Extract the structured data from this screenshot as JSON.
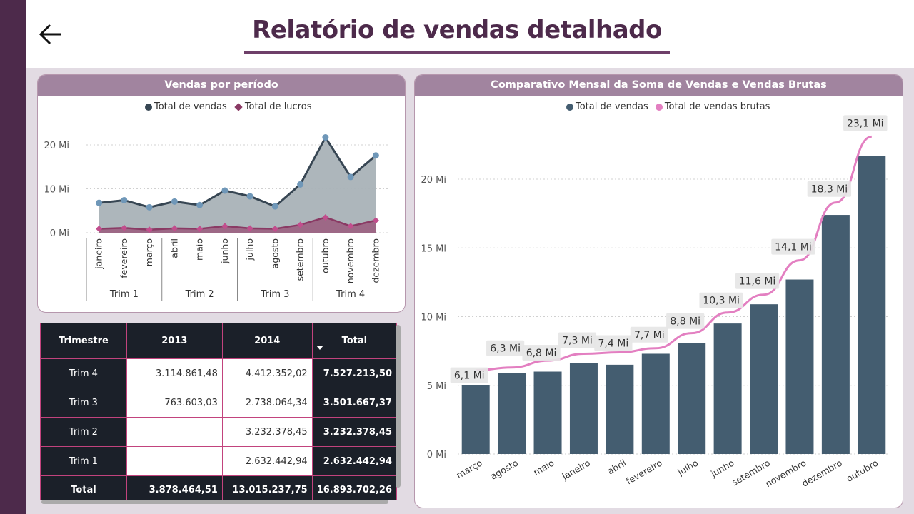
{
  "header": {
    "title": "Relatório de vendas detalhado",
    "back_icon": "arrow-left-icon"
  },
  "colors": {
    "sidebar": "#4d2a4b",
    "card_header": "#a1849f",
    "sales": "#374653",
    "profit": "#8a3a64",
    "gross": "#e37fc1",
    "bar": "#445d70"
  },
  "left_chart": {
    "header": "Vendas por período",
    "legend": [
      "Total de vendas",
      "Total de lucros"
    ]
  },
  "right_chart": {
    "header": "Comparativo Mensal da Soma de Vendas e Vendas Brutas",
    "legend": [
      "Total de vendas",
      "Total de vendas brutas"
    ]
  },
  "table": {
    "headers": [
      "Trimestre",
      "2013",
      "2014",
      "Total"
    ],
    "rows": [
      [
        "Trim 4",
        "3.114.861,48",
        "4.412.352,02",
        "7.527.213,50"
      ],
      [
        "Trim 3",
        "763.603,03",
        "2.738.064,34",
        "3.501.667,37"
      ],
      [
        "Trim 2",
        "",
        "3.232.378,45",
        "3.232.378,45"
      ],
      [
        "Trim 1",
        "",
        "2.632.442,94",
        "2.632.442,94"
      ]
    ],
    "total_row": [
      "Total",
      "3.878.464,51",
      "13.015.237,75",
      "16.893.702,26"
    ]
  },
  "chart_data": [
    {
      "type": "area",
      "title": "Vendas por período",
      "categories": [
        "janeiro",
        "fevereiro",
        "março",
        "abril",
        "maio",
        "junho",
        "julho",
        "agosto",
        "setembro",
        "outubro",
        "novembro",
        "dezembro"
      ],
      "groups": [
        {
          "label": "Trim 1",
          "count": 3
        },
        {
          "label": "Trim 2",
          "count": 3
        },
        {
          "label": "Trim 3",
          "count": 3
        },
        {
          "label": "Trim 4",
          "count": 3
        }
      ],
      "series": [
        {
          "name": "Total de vendas",
          "values": [
            6.8,
            7.4,
            5.8,
            7.1,
            6.3,
            9.6,
            8.3,
            6.0,
            11.0,
            21.7,
            12.7,
            17.6
          ]
        },
        {
          "name": "Total de lucros",
          "values": [
            0.9,
            1.1,
            0.7,
            1.0,
            0.9,
            1.5,
            1.0,
            0.9,
            1.8,
            3.5,
            1.5,
            2.8
          ]
        }
      ],
      "yticks": [
        "0 Mi",
        "10 Mi",
        "20 Mi"
      ],
      "ylim": [
        0,
        23
      ]
    },
    {
      "type": "bar",
      "title": "Comparativo Mensal da Soma de Vendas e Vendas Brutas",
      "categories": [
        "março",
        "agosto",
        "maio",
        "janeiro",
        "abril",
        "fevereiro",
        "julho",
        "junho",
        "setembro",
        "novembro",
        "dezembro",
        "outubro"
      ],
      "series": [
        {
          "name": "Total de vendas",
          "type": "bar",
          "values": [
            5.0,
            5.9,
            6.0,
            6.6,
            6.5,
            7.3,
            8.1,
            9.5,
            10.9,
            12.7,
            17.4,
            21.7
          ]
        },
        {
          "name": "Total de vendas brutas",
          "type": "line",
          "values": [
            6.1,
            6.3,
            6.8,
            7.3,
            7.4,
            7.7,
            8.8,
            10.3,
            11.6,
            14.1,
            18.3,
            23.1
          ]
        }
      ],
      "data_labels": [
        "6,1 Mi",
        "6,3 Mi",
        "6,8 Mi",
        "7,3 Mi",
        "7,4 Mi",
        "7,7 Mi",
        "8,8 Mi",
        "10,3 Mi",
        "11,6 Mi",
        "14,1 Mi",
        "18,3 Mi",
        "23,1 Mi"
      ],
      "yticks": [
        "0 Mi",
        "5 Mi",
        "10 Mi",
        "15 Mi",
        "20 Mi"
      ],
      "ylim": [
        0,
        23.5
      ]
    }
  ]
}
